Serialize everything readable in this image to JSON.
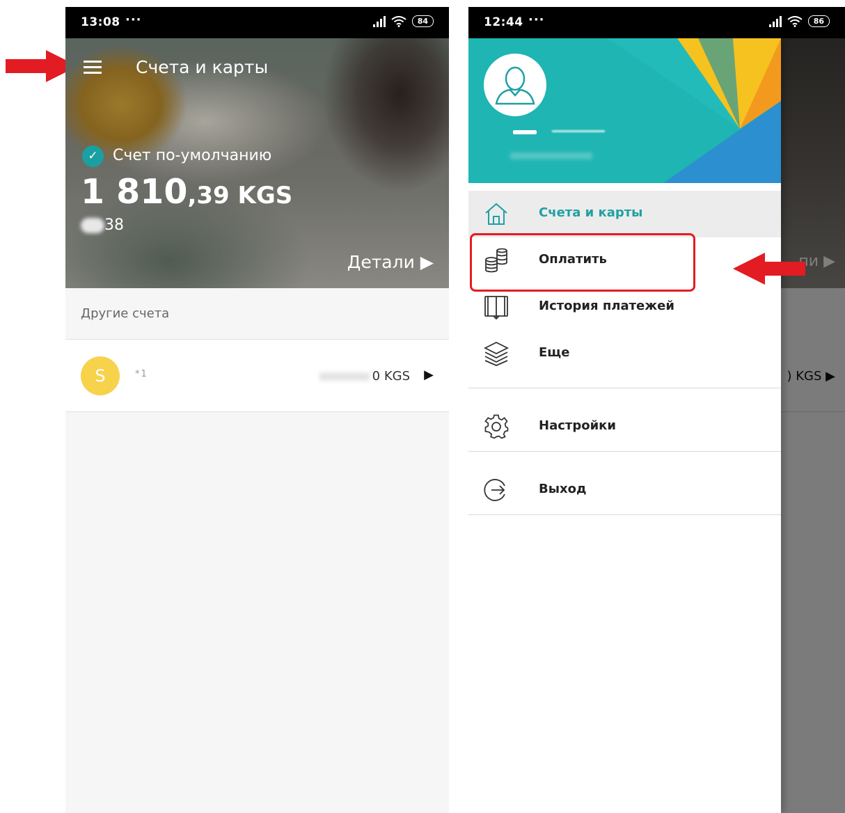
{
  "left_screen": {
    "status": {
      "time": "13:08",
      "dots": "···",
      "battery": "84"
    },
    "header": {
      "title": "Счета и карты"
    },
    "default_account": {
      "label": "Счет по-умолчанию",
      "balance_main": "1 810",
      "balance_fraction": ",39 KGS",
      "account_suffix": "38",
      "details_link": "Детали ▶"
    },
    "other_accounts": {
      "section_title": "Другие счета",
      "rows": [
        {
          "avatar_letter": "S",
          "masked_number": "*1",
          "amount_suffix": "0 KGS",
          "arrow": "▶"
        }
      ]
    }
  },
  "right_screen": {
    "status": {
      "time": "12:44",
      "dots": "···",
      "battery": "86"
    },
    "drawer": {
      "menu": [
        {
          "label": "Счета и карты",
          "icon": "home-icon",
          "active": true
        },
        {
          "label": "Оплатить",
          "icon": "coins-icon",
          "active": false
        },
        {
          "label": "История платежей",
          "icon": "book-icon",
          "active": false
        },
        {
          "label": "Еще",
          "icon": "layers-icon",
          "active": false
        },
        {
          "label": "Настройки",
          "icon": "gear-icon",
          "active": false
        },
        {
          "label": "Выход",
          "icon": "logout-icon",
          "active": false
        }
      ]
    },
    "background": {
      "details_fragment": "пи ▶",
      "amount_fragment": ") KGS ▶"
    }
  },
  "colors": {
    "accent": "#1fa0a3",
    "annotation_red": "#e31b23",
    "avatar_yellow": "#f7d24b"
  }
}
